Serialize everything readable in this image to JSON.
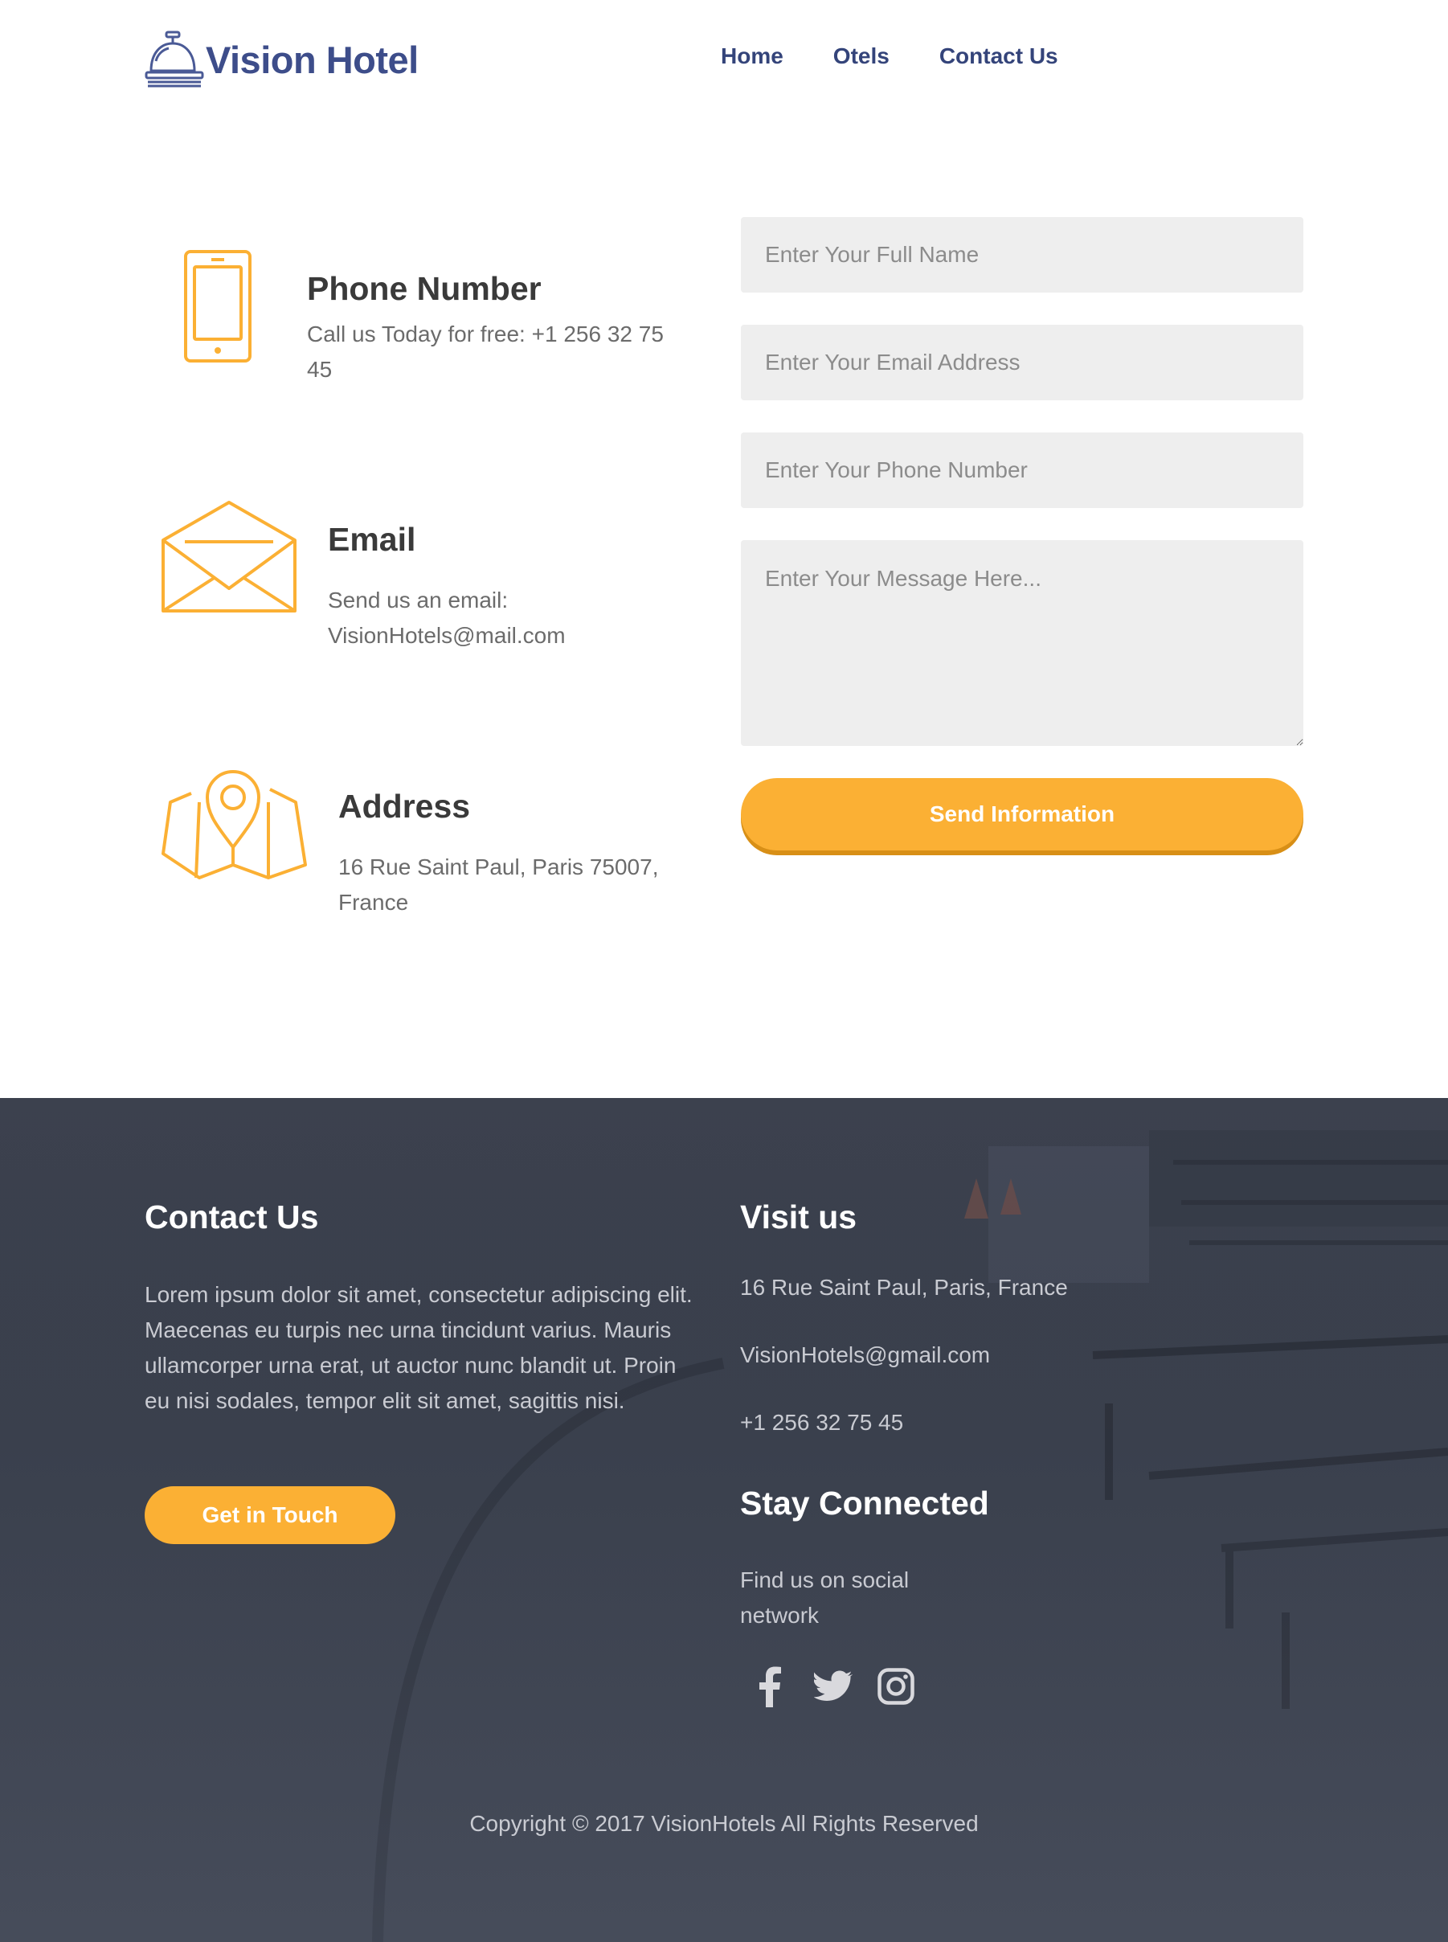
{
  "header": {
    "logo_text": "Vision Hotel",
    "nav": [
      "Home",
      "Otels",
      "Contact Us"
    ]
  },
  "contact_info": {
    "phone": {
      "title": "Phone Number",
      "text": "Call us Today for free: +1 256 32 75 45",
      "icon": "smartphone-icon"
    },
    "email": {
      "title": "Email",
      "text": "Send us an email: VisionHotels@mail.com",
      "icon": "envelope-icon"
    },
    "address": {
      "title": "Address",
      "text": "16 Rue Saint Paul, Paris 75007, France",
      "icon": "map-pin-icon"
    }
  },
  "form": {
    "name_placeholder": "Enter Your Full Name",
    "email_placeholder": "Enter Your Email Address",
    "phone_placeholder": "Enter Your Phone Number",
    "message_placeholder": "Enter Your Message Here...",
    "submit_label": "Send Information"
  },
  "footer": {
    "contact_title": "Contact Us",
    "contact_text": "Lorem ipsum dolor sit amet, consectetur adipiscing elit. Maecenas eu turpis nec urna tincidunt varius. Mauris ullamcorper urna erat, ut auctor nunc blandit ut. Proin eu nisi sodales, tempor elit sit amet, sagittis nisi.",
    "touch_label": "Get in Touch",
    "visit_title": "Visit us",
    "visit_address": "16 Rue Saint Paul, Paris, France",
    "visit_email": "VisionHotels@gmail.com",
    "visit_phone": "+1 256 32 75 45",
    "stay_title": "Stay Connected",
    "stay_text": "Find us on social network",
    "social": [
      "facebook-icon",
      "twitter-icon",
      "instagram-icon"
    ],
    "copyright": "Copyright © 2017 VisionHotels All Rights Reserved"
  },
  "colors": {
    "accent": "#fbb034",
    "brand": "#3d4d8a",
    "footer_bg": "#3c414e",
    "field_bg": "#eeeeee"
  }
}
